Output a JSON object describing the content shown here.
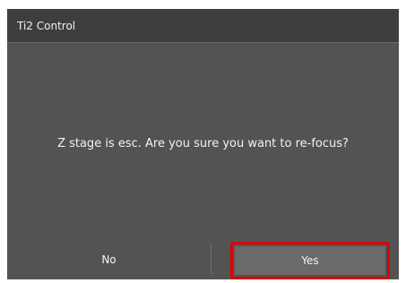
{
  "dialog": {
    "title": "Ti2 Control",
    "message": "Z stage is esc. Are you sure you want to re-focus?",
    "buttons": {
      "no_label": "No",
      "yes_label": "Yes"
    },
    "highlight_color": "#e00000"
  }
}
